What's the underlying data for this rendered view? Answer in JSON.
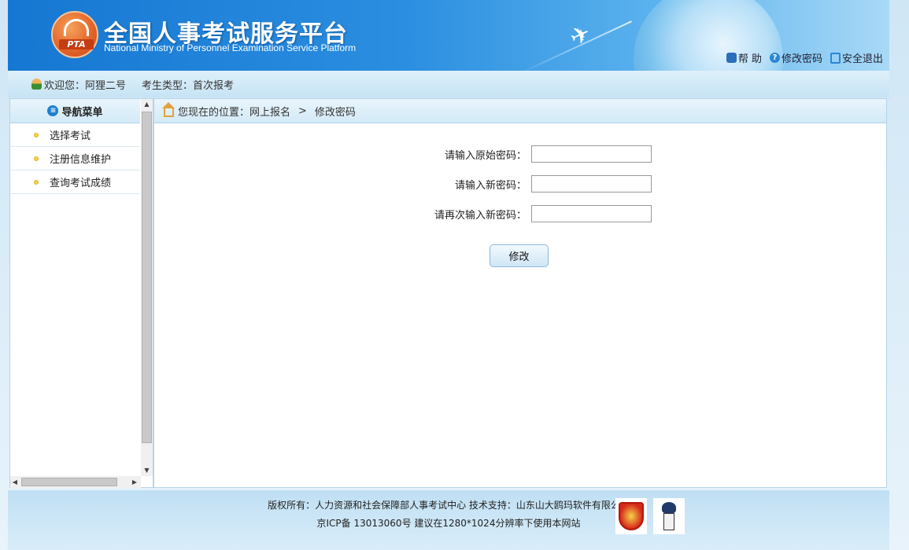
{
  "header": {
    "title": "全国人事考试服务平台",
    "subtitle": "National Ministry of Personnel Examination Service Platform",
    "logo_text": "PTA",
    "links": [
      {
        "label": "帮 助",
        "icon": "lock-icon"
      },
      {
        "label": "修改密码",
        "icon": "help-circle-icon"
      },
      {
        "label": "安全退出",
        "icon": "exit-icon"
      }
    ]
  },
  "userbar": {
    "welcome": "欢迎您：阿狸二号",
    "candidate_type": "考生类型：首次报考"
  },
  "sidebar": {
    "title": "导航菜单",
    "items": [
      {
        "label": "选择考试"
      },
      {
        "label": "注册信息维护"
      },
      {
        "label": "查询考试成绩"
      }
    ]
  },
  "breadcrumb": {
    "prefix": "您现在的位置：网上报名",
    "separator": ">",
    "current": "修改密码"
  },
  "form": {
    "old_password_label": "请输入原始密码：",
    "old_password_value": "",
    "new_password_label": "请输入新密码：",
    "new_password_value": "",
    "confirm_password_label": "请再次输入新密码：",
    "confirm_password_value": "",
    "submit_label": "修改"
  },
  "footer": {
    "line1": "版权所有：人力资源和社会保障部人事考试中心   技术支持：山东山大鸥玛软件有限公司",
    "line2": "京ICP备 13013060号   建议在1280*1024分辨率下使用本网站"
  },
  "colors": {
    "header_blue": "#1677d2",
    "accent_light": "#d3eaf7"
  }
}
